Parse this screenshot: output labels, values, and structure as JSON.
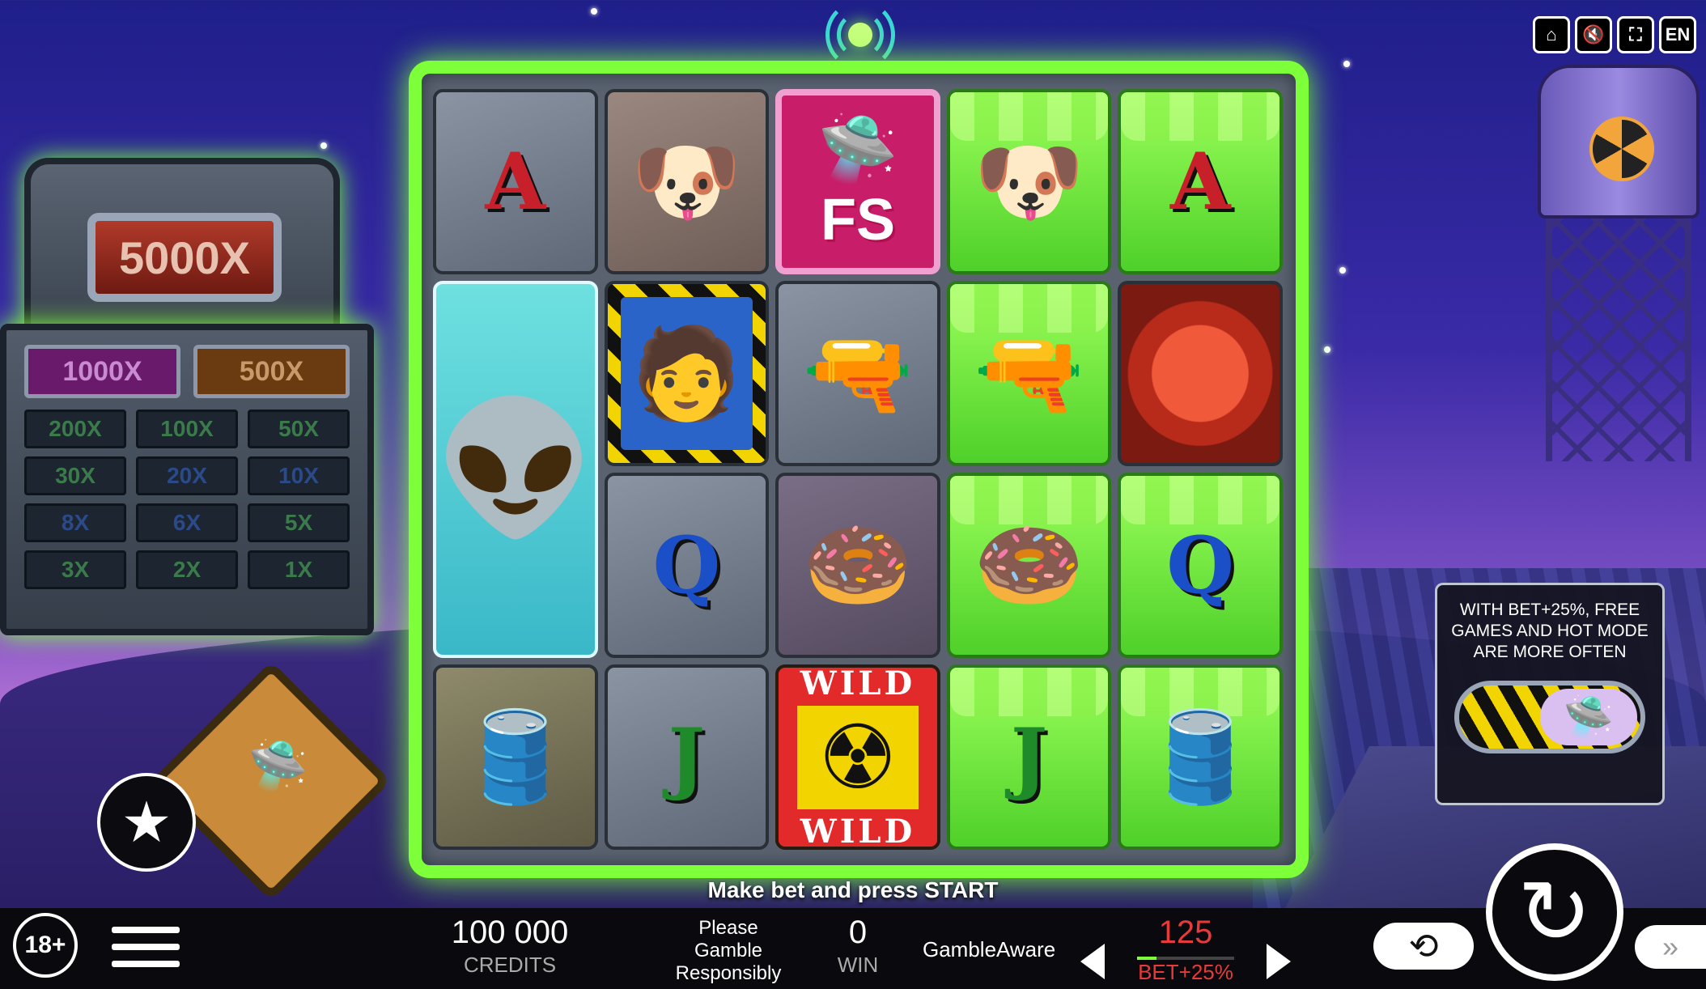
{
  "top_controls": {
    "home_icon": "home-icon",
    "sound_icon": "sound-muted-icon",
    "fullscreen_icon": "fullscreen-icon",
    "language": "EN"
  },
  "multipliers": {
    "top": "5000X",
    "row2": [
      "1000X",
      "500X"
    ],
    "grid": [
      "200X",
      "100X",
      "50X",
      "30X",
      "20X",
      "10X",
      "8X",
      "6X",
      "5X",
      "3X",
      "2X",
      "1X"
    ]
  },
  "reels": {
    "row1": [
      {
        "type": "letter",
        "value": "A",
        "bg": "stone"
      },
      {
        "type": "emoji",
        "value": "🐶",
        "bg": "brown",
        "icon": "pug-icon"
      },
      {
        "type": "fs",
        "value": "FS",
        "icon": "ufo-icon"
      },
      {
        "type": "emoji",
        "value": "🐶",
        "bg": "slime",
        "icon": "pug-icon"
      },
      {
        "type": "letter",
        "value": "A",
        "bg": "slime"
      }
    ],
    "row2": [
      {
        "type": "hazard",
        "value": "🧑",
        "icon": "farmer-icon"
      },
      {
        "type": "emoji",
        "value": "🔫",
        "bg": "stone",
        "icon": "ray-gun-icon"
      },
      {
        "type": "alien",
        "value": "👽",
        "icon": "alien-octopus-icon"
      },
      {
        "type": "emoji",
        "value": "🔫",
        "bg": "slime",
        "icon": "ray-gun-icon"
      },
      {
        "type": "red",
        "value": "",
        "icon": "portal-icon"
      }
    ],
    "row3": [
      {
        "type": "letter",
        "value": "Q",
        "bg": "stone"
      },
      {
        "type": "emoji",
        "value": "🍩",
        "bg": "purple",
        "icon": "donut-icon"
      },
      null,
      {
        "type": "emoji",
        "value": "🍩",
        "bg": "slime",
        "icon": "donut-icon"
      },
      {
        "type": "letter",
        "value": "Q",
        "bg": "slime"
      }
    ],
    "row4": [
      {
        "type": "emoji",
        "value": "🛢️",
        "bg": "olive",
        "icon": "toxic-barrel-icon"
      },
      {
        "type": "letter",
        "value": "J",
        "bg": "stone"
      },
      {
        "type": "wild",
        "value": "WILD",
        "icon": "radiation-icon"
      },
      {
        "type": "letter",
        "value": "J",
        "bg": "slime"
      },
      {
        "type": "emoji",
        "value": "🛢️",
        "bg": "slime",
        "icon": "toxic-barrel-icon"
      }
    ]
  },
  "prompt": "Make bet and press START",
  "promo": {
    "text": "WITH BET+25%, FREE GAMES AND HOT MODE ARE MORE OFTEN"
  },
  "bottom": {
    "age": "18+",
    "credits_value": "100 000",
    "credits_label": "CREDITS",
    "responsible": [
      "Please",
      "Gamble",
      "Responsibly"
    ],
    "win_value": "0",
    "win_label": "WIN",
    "gamble_aware": "GambleAware",
    "bet_value": "125",
    "bet_label": "BET+25%",
    "bet_level": 0.2
  },
  "colors": {
    "slime": "#7dff3a",
    "bet_red": "#e83a3a"
  }
}
